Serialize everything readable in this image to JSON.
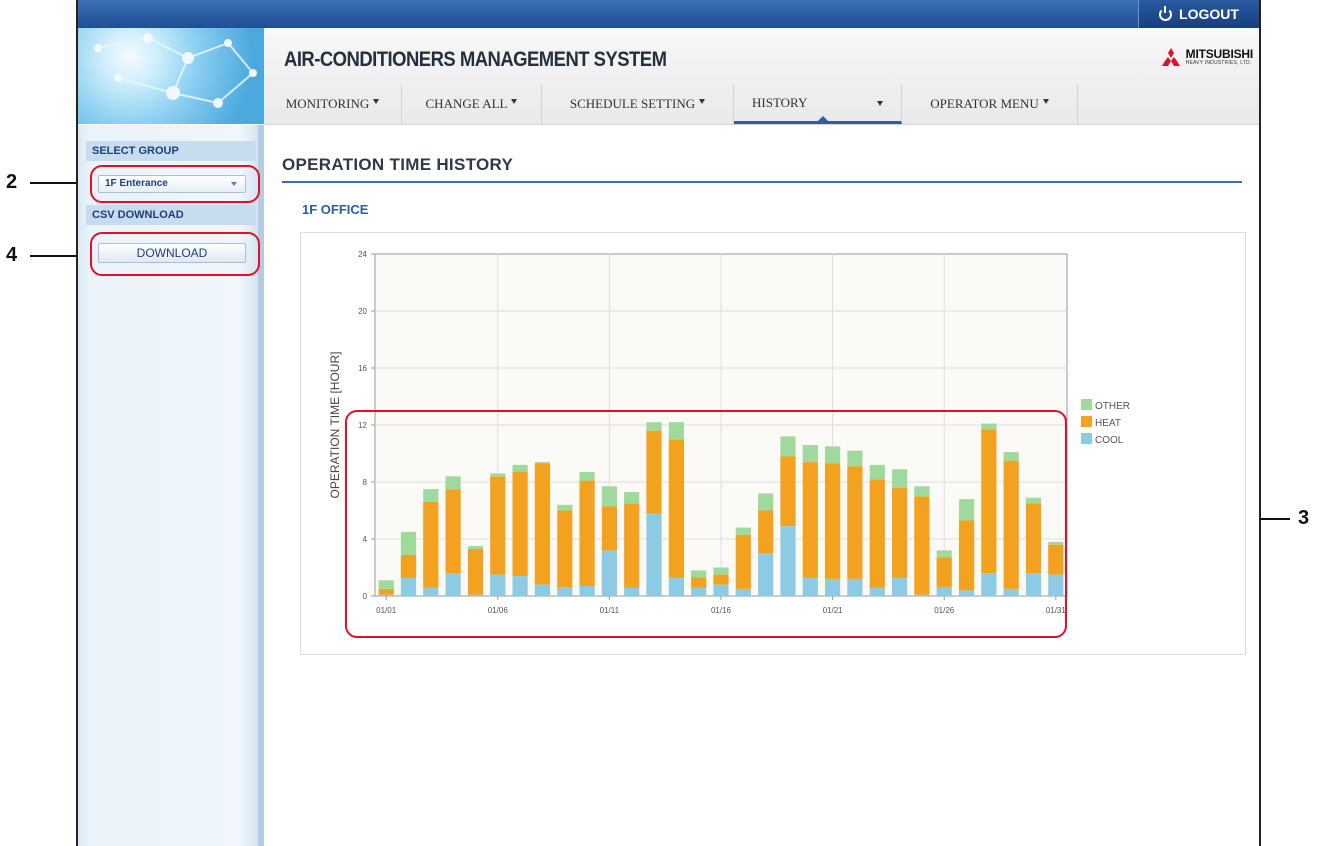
{
  "header": {
    "logout_label": "LOGOUT",
    "app_title": "AIR-CONDITIONERS MANAGEMENT SYSTEM",
    "brand_name": "MITSUBISHI",
    "brand_sub": "HEAVY INDUSTRIES, LTD."
  },
  "nav": {
    "items": [
      {
        "label": "MONITORING"
      },
      {
        "label": "CHANGE ALL"
      },
      {
        "label": "SCHEDULE SETTING"
      },
      {
        "label": "HISTORY"
      },
      {
        "label": "OPERATOR MENU"
      }
    ],
    "active": "HISTORY"
  },
  "sidebar": {
    "select_group_heading": "SELECT GROUP",
    "group_value": "1F Enterance",
    "csv_heading": "CSV DOWNLOAD",
    "download_label": "DOWNLOAD"
  },
  "main": {
    "page_title": "OPERATION TIME HISTORY",
    "group_title": "1F OFFICE"
  },
  "callouts": {
    "select": "2",
    "chart": "3",
    "download": "4"
  },
  "colors": {
    "cool": "#8ccbe3",
    "heat": "#f3a21f",
    "other": "#9fd99b",
    "callout": "#e0102a",
    "nav_active": "#2f5da6"
  },
  "chart_data": {
    "type": "bar",
    "stacked": true,
    "ylabel": "OPERATION TIME [HOUR]",
    "ylim": [
      0,
      24
    ],
    "yticks": [
      0,
      4,
      8,
      12,
      16,
      20,
      24
    ],
    "grid": true,
    "legend_placement": "right",
    "categories": [
      "01/01",
      "01/02",
      "01/03",
      "01/04",
      "01/05",
      "01/06",
      "01/07",
      "01/08",
      "01/09",
      "01/10",
      "01/11",
      "01/12",
      "01/13",
      "01/14",
      "01/15",
      "01/16",
      "01/17",
      "01/18",
      "01/19",
      "01/20",
      "01/21",
      "01/22",
      "01/23",
      "01/24",
      "01/25",
      "01/26",
      "01/27",
      "01/28",
      "01/29",
      "01/30",
      "01/31"
    ],
    "xtick_labels": [
      "01/01",
      "01/06",
      "01/11",
      "01/16",
      "01/21",
      "01/26",
      "01/31"
    ],
    "series": [
      {
        "name": "COOL",
        "color": "#8ccbe3",
        "values": [
          0.1,
          1.3,
          0.6,
          1.6,
          0.1,
          1.5,
          1.4,
          0.8,
          0.6,
          0.7,
          3.2,
          0.6,
          5.8,
          1.3,
          0.6,
          0.8,
          0.5,
          3.0,
          4.9,
          1.3,
          1.2,
          1.2,
          0.6,
          1.3,
          0.1,
          0.6,
          0.4,
          1.6,
          0.5,
          1.6,
          1.5
        ]
      },
      {
        "name": "HEAT",
        "color": "#f3a21f",
        "values": [
          0.4,
          1.6,
          6.0,
          5.9,
          3.2,
          6.9,
          7.3,
          8.5,
          5.4,
          7.4,
          3.1,
          5.9,
          5.8,
          9.7,
          0.7,
          0.7,
          3.8,
          3.0,
          4.9,
          8.1,
          8.1,
          7.9,
          7.6,
          6.3,
          6.9,
          2.1,
          4.9,
          10.1,
          9.0,
          4.9,
          2.1
        ]
      },
      {
        "name": "OTHER",
        "color": "#9fd99b",
        "values": [
          0.6,
          1.6,
          0.9,
          0.9,
          0.2,
          0.2,
          0.5,
          0.1,
          0.4,
          0.6,
          1.4,
          0.8,
          0.6,
          1.2,
          0.5,
          0.5,
          0.5,
          1.2,
          1.4,
          1.2,
          1.2,
          1.1,
          1.0,
          1.3,
          0.7,
          0.5,
          1.5,
          0.4,
          0.6,
          0.4,
          0.2
        ]
      }
    ]
  }
}
